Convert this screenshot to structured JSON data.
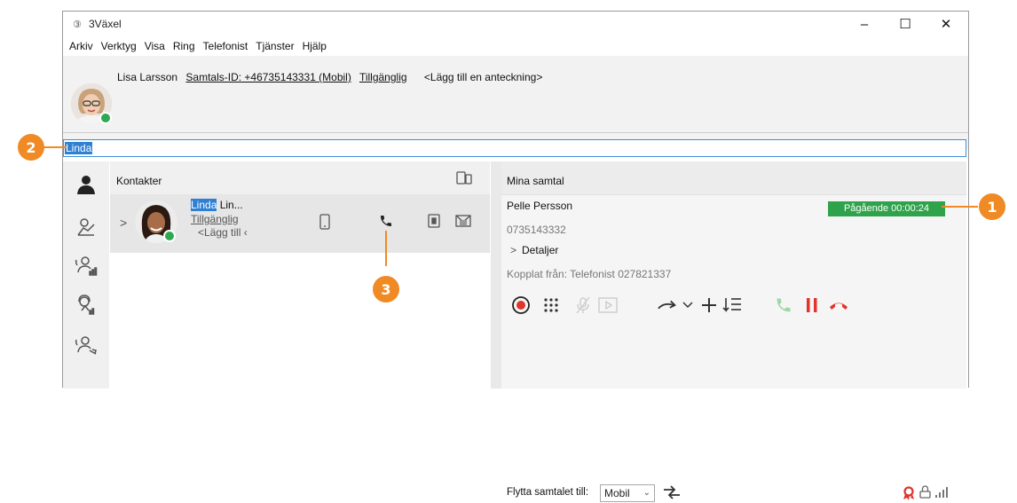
{
  "window": {
    "logo_glyph": "③",
    "title": "3Växel",
    "minimize": "–",
    "maximize": "☐",
    "close": "✕"
  },
  "menu": [
    "Arkiv",
    "Verktyg",
    "Visa",
    "Ring",
    "Telefonist",
    "Tjänster",
    "Hjälp"
  ],
  "user": {
    "name": "Lisa Larsson",
    "call_id": "Samtals-ID: +46735143331 (Mobil)",
    "status": "Tillgänglig",
    "note": "<Lägg till en anteckning>"
  },
  "search": {
    "value": "Linda"
  },
  "contacts": {
    "title": "Kontakter",
    "row": {
      "name_match": "Linda",
      "name_rest": " Lin...",
      "status": "Tillgänglig",
      "note": "<Lägg till ‹"
    }
  },
  "calls": {
    "title": "Mina samtal",
    "caller": "Pelle Persson",
    "status_badge": "Pågående 00:00:24",
    "number": "0735143332",
    "details": "Detaljer",
    "transferred_from": "Kopplat från: Telefonist 027821337",
    "move_label": "Flytta samtalet till:",
    "move_option": "Mobil"
  },
  "callouts": [
    "1",
    "2",
    "3"
  ],
  "colors": {
    "accent_blue": "#2f7fd3",
    "status_green": "#2fa34b",
    "hangup_red": "#e0342c",
    "callout_orange": "#f08a24"
  }
}
